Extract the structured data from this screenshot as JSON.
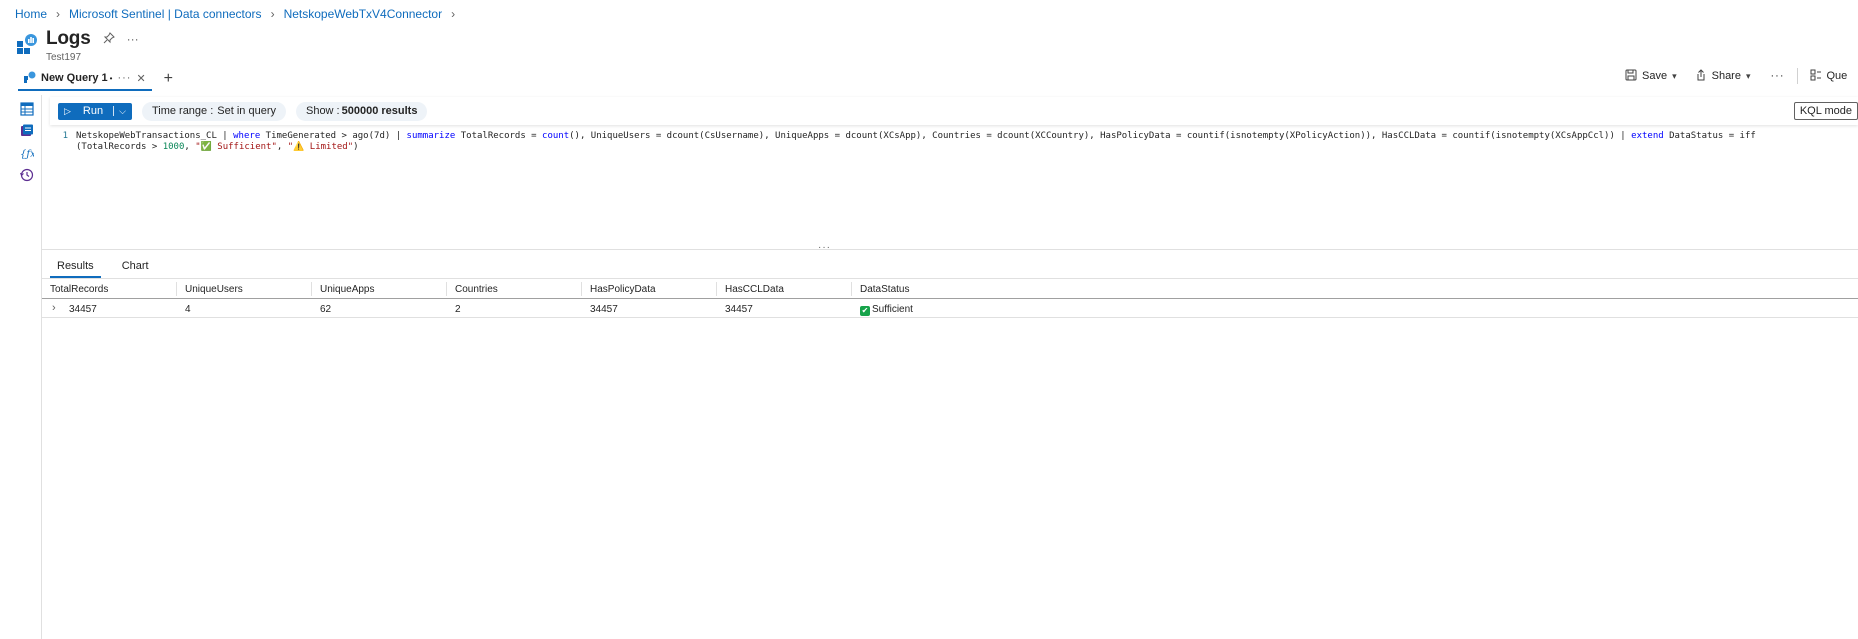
{
  "breadcrumb": {
    "home": "Home",
    "sentinel": "Microsoft Sentinel | Data connectors",
    "connector": "NetskopeWebTxV4Connector"
  },
  "header": {
    "title": "Logs",
    "subtitle": "Test197",
    "more": "···"
  },
  "tabs": {
    "query_tab_label": "New Query 1",
    "modified_marker": "•",
    "dots": "···",
    "close": "✕",
    "add": "+"
  },
  "right_toolbar": {
    "save": "Save",
    "share": "Share",
    "more": "···",
    "queries_cut": "Que"
  },
  "query_toolbar": {
    "run": "Run",
    "time_range_label": "Time range :",
    "time_range_value": "Set in query",
    "show_label": "Show :",
    "show_value": "500000 results",
    "kql_mode": "KQL mode"
  },
  "editor": {
    "line_number": "1",
    "line1": {
      "t1": "NetskopeWebTransactions_CL | ",
      "k1": "where",
      "t2": " TimeGenerated > ago(7d) | ",
      "k2": "summarize",
      "t3": " TotalRecords = ",
      "k3": "count",
      "t4": "(), UniqueUsers = dcount(CsUsername), UniqueApps = dcount(XCsApp), Countries = dcount(XCCountry), HasPolicyData = countif(isnotempty(XPolicyAction)), HasCCLData = countif(isnotempty(XCsAppCcl)) | ",
      "k4": "extend",
      "t5": " DataStatus = iff"
    },
    "line2": {
      "t1": "(TotalRecords > ",
      "n1": "1000",
      "t2": ", ",
      "s1": "\"✅ Sufficient\"",
      "t3": ", ",
      "s2": "\"⚠️ Limited\"",
      "t4": ")"
    }
  },
  "results": {
    "tabs": [
      "Results",
      "Chart"
    ],
    "columns": [
      "TotalRecords",
      "UniqueUsers",
      "UniqueApps",
      "Countries",
      "HasPolicyData",
      "HasCCLData",
      "DataStatus"
    ],
    "rows": [
      [
        "34457",
        "4",
        "62",
        "2",
        "34457",
        "34457",
        "Sufficient"
      ]
    ],
    "status_emoji": "✔"
  },
  "colors": {
    "accent": "#0f6cbd",
    "keyword": "#0000ff",
    "number": "#098658",
    "string": "#a31515"
  },
  "icons": {
    "rail": [
      "tables-icon",
      "queries-icon",
      "functions-icon",
      "history-icon"
    ]
  }
}
